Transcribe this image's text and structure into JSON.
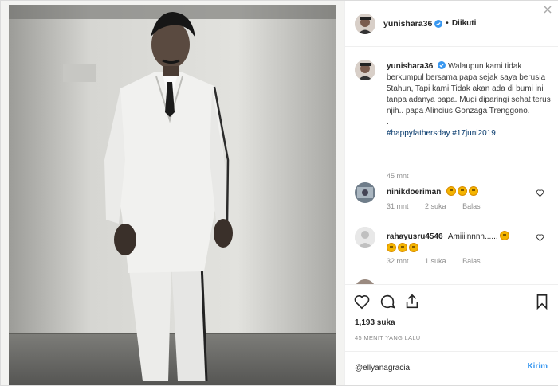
{
  "post": {
    "username": "yunishara36",
    "follow_state": "Diikuti",
    "dot": "•",
    "caption_text": "Walaupun kami tidak berkumpul bersama papa sejak saya berusia 5tahun, Tapi kami Tidak akan ada di bumi ini tanpa adanya papa. Mugi diparingi sehat terus njih.. papa Alincius Gonzaga Trenggono.",
    "caption_dot": ".",
    "hashtags": "#happyfathersday #17juni2019",
    "caption_time": "45 mnt"
  },
  "comments": [
    {
      "username": "ninikdoeriman",
      "text": "",
      "time": "31 mnt",
      "likes": "2 suka",
      "reply": "Balas"
    },
    {
      "username": "rahayusru4546",
      "text": "Amiiiinnnn......",
      "time": "32 mnt",
      "likes": "1 suka",
      "reply": "Balas"
    }
  ],
  "actions": {
    "likes": "1,193 suka",
    "time_ago": "45 MENIT YANG LALU"
  },
  "add_comment": {
    "value": "@ellyanagracia",
    "post_label": "Kirim"
  },
  "colors": {
    "link": "#3897f0",
    "hashtag": "#003569",
    "verified": "#3897f0"
  }
}
